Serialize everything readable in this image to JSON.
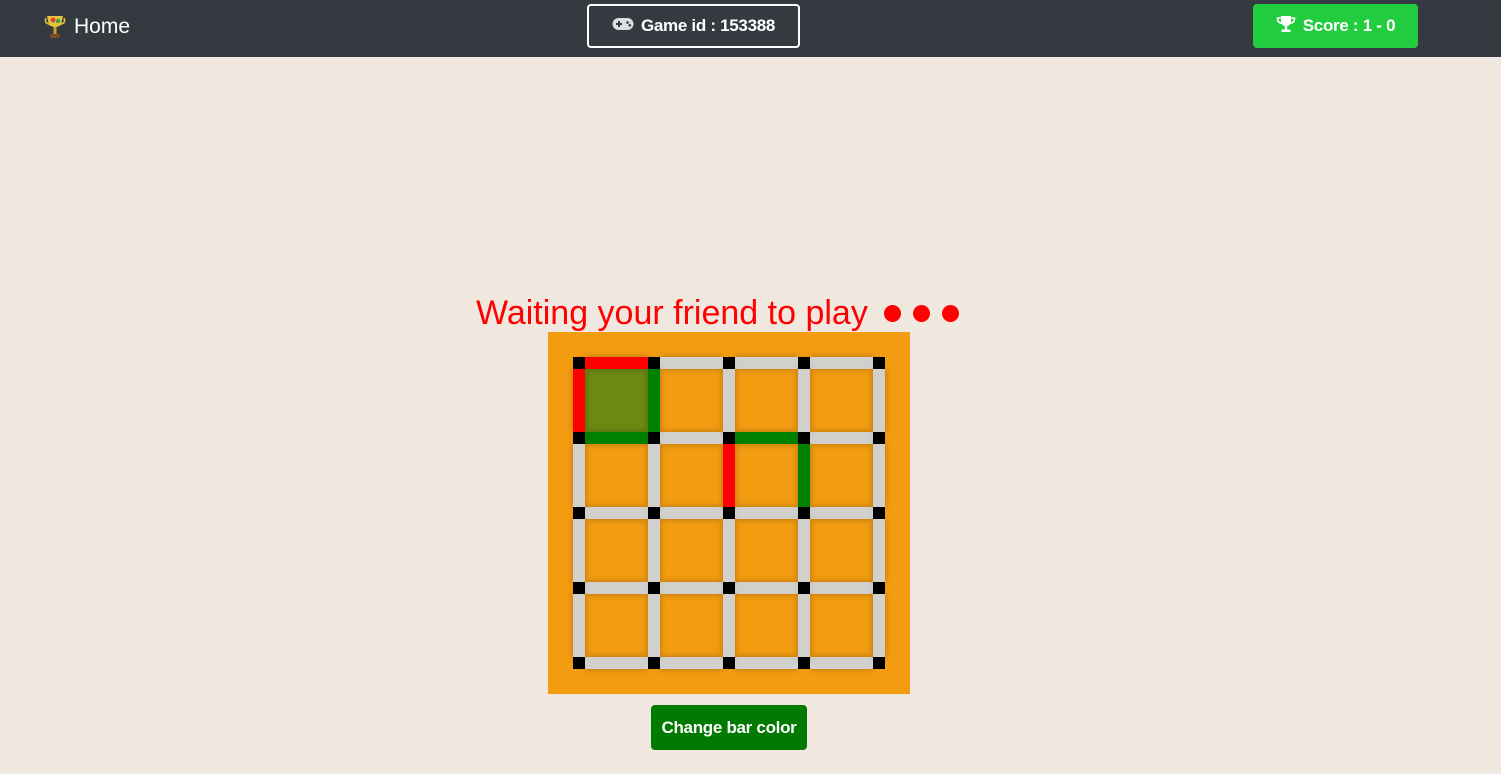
{
  "nav": {
    "home_label": "Home",
    "game_id_label": "Game id : 153388",
    "score_label": "Score : 1 - 0"
  },
  "status": {
    "text": "Waiting your friend to play",
    "dot_count": 3
  },
  "board": {
    "size": 4,
    "colors": {
      "board": "#f39c12",
      "empty_bar": "#d2d0cd",
      "node": "#000000",
      "player1": "#ff0000",
      "player2": "#008000",
      "claimed_box": "#6b8a12"
    },
    "horizontal_bars": [
      [
        "player1",
        "empty",
        "empty",
        "empty"
      ],
      [
        "player2",
        "empty",
        "player2",
        "empty"
      ],
      [
        "empty",
        "empty",
        "empty",
        "empty"
      ],
      [
        "empty",
        "empty",
        "empty",
        "empty"
      ],
      [
        "empty",
        "empty",
        "empty",
        "empty"
      ]
    ],
    "vertical_bars": [
      [
        "player1",
        "player2",
        "empty",
        "empty",
        "empty"
      ],
      [
        "empty",
        "empty",
        "player1",
        "player2",
        "empty"
      ],
      [
        "empty",
        "empty",
        "empty",
        "empty",
        "empty"
      ],
      [
        "empty",
        "empty",
        "empty",
        "empty",
        "empty"
      ]
    ],
    "boxes": [
      [
        "claimed",
        "empty",
        "empty",
        "empty"
      ],
      [
        "empty",
        "empty",
        "empty",
        "empty"
      ],
      [
        "empty",
        "empty",
        "empty",
        "empty"
      ],
      [
        "empty",
        "empty",
        "empty",
        "empty"
      ]
    ]
  },
  "actions": {
    "change_bar_color": "Change bar color"
  }
}
